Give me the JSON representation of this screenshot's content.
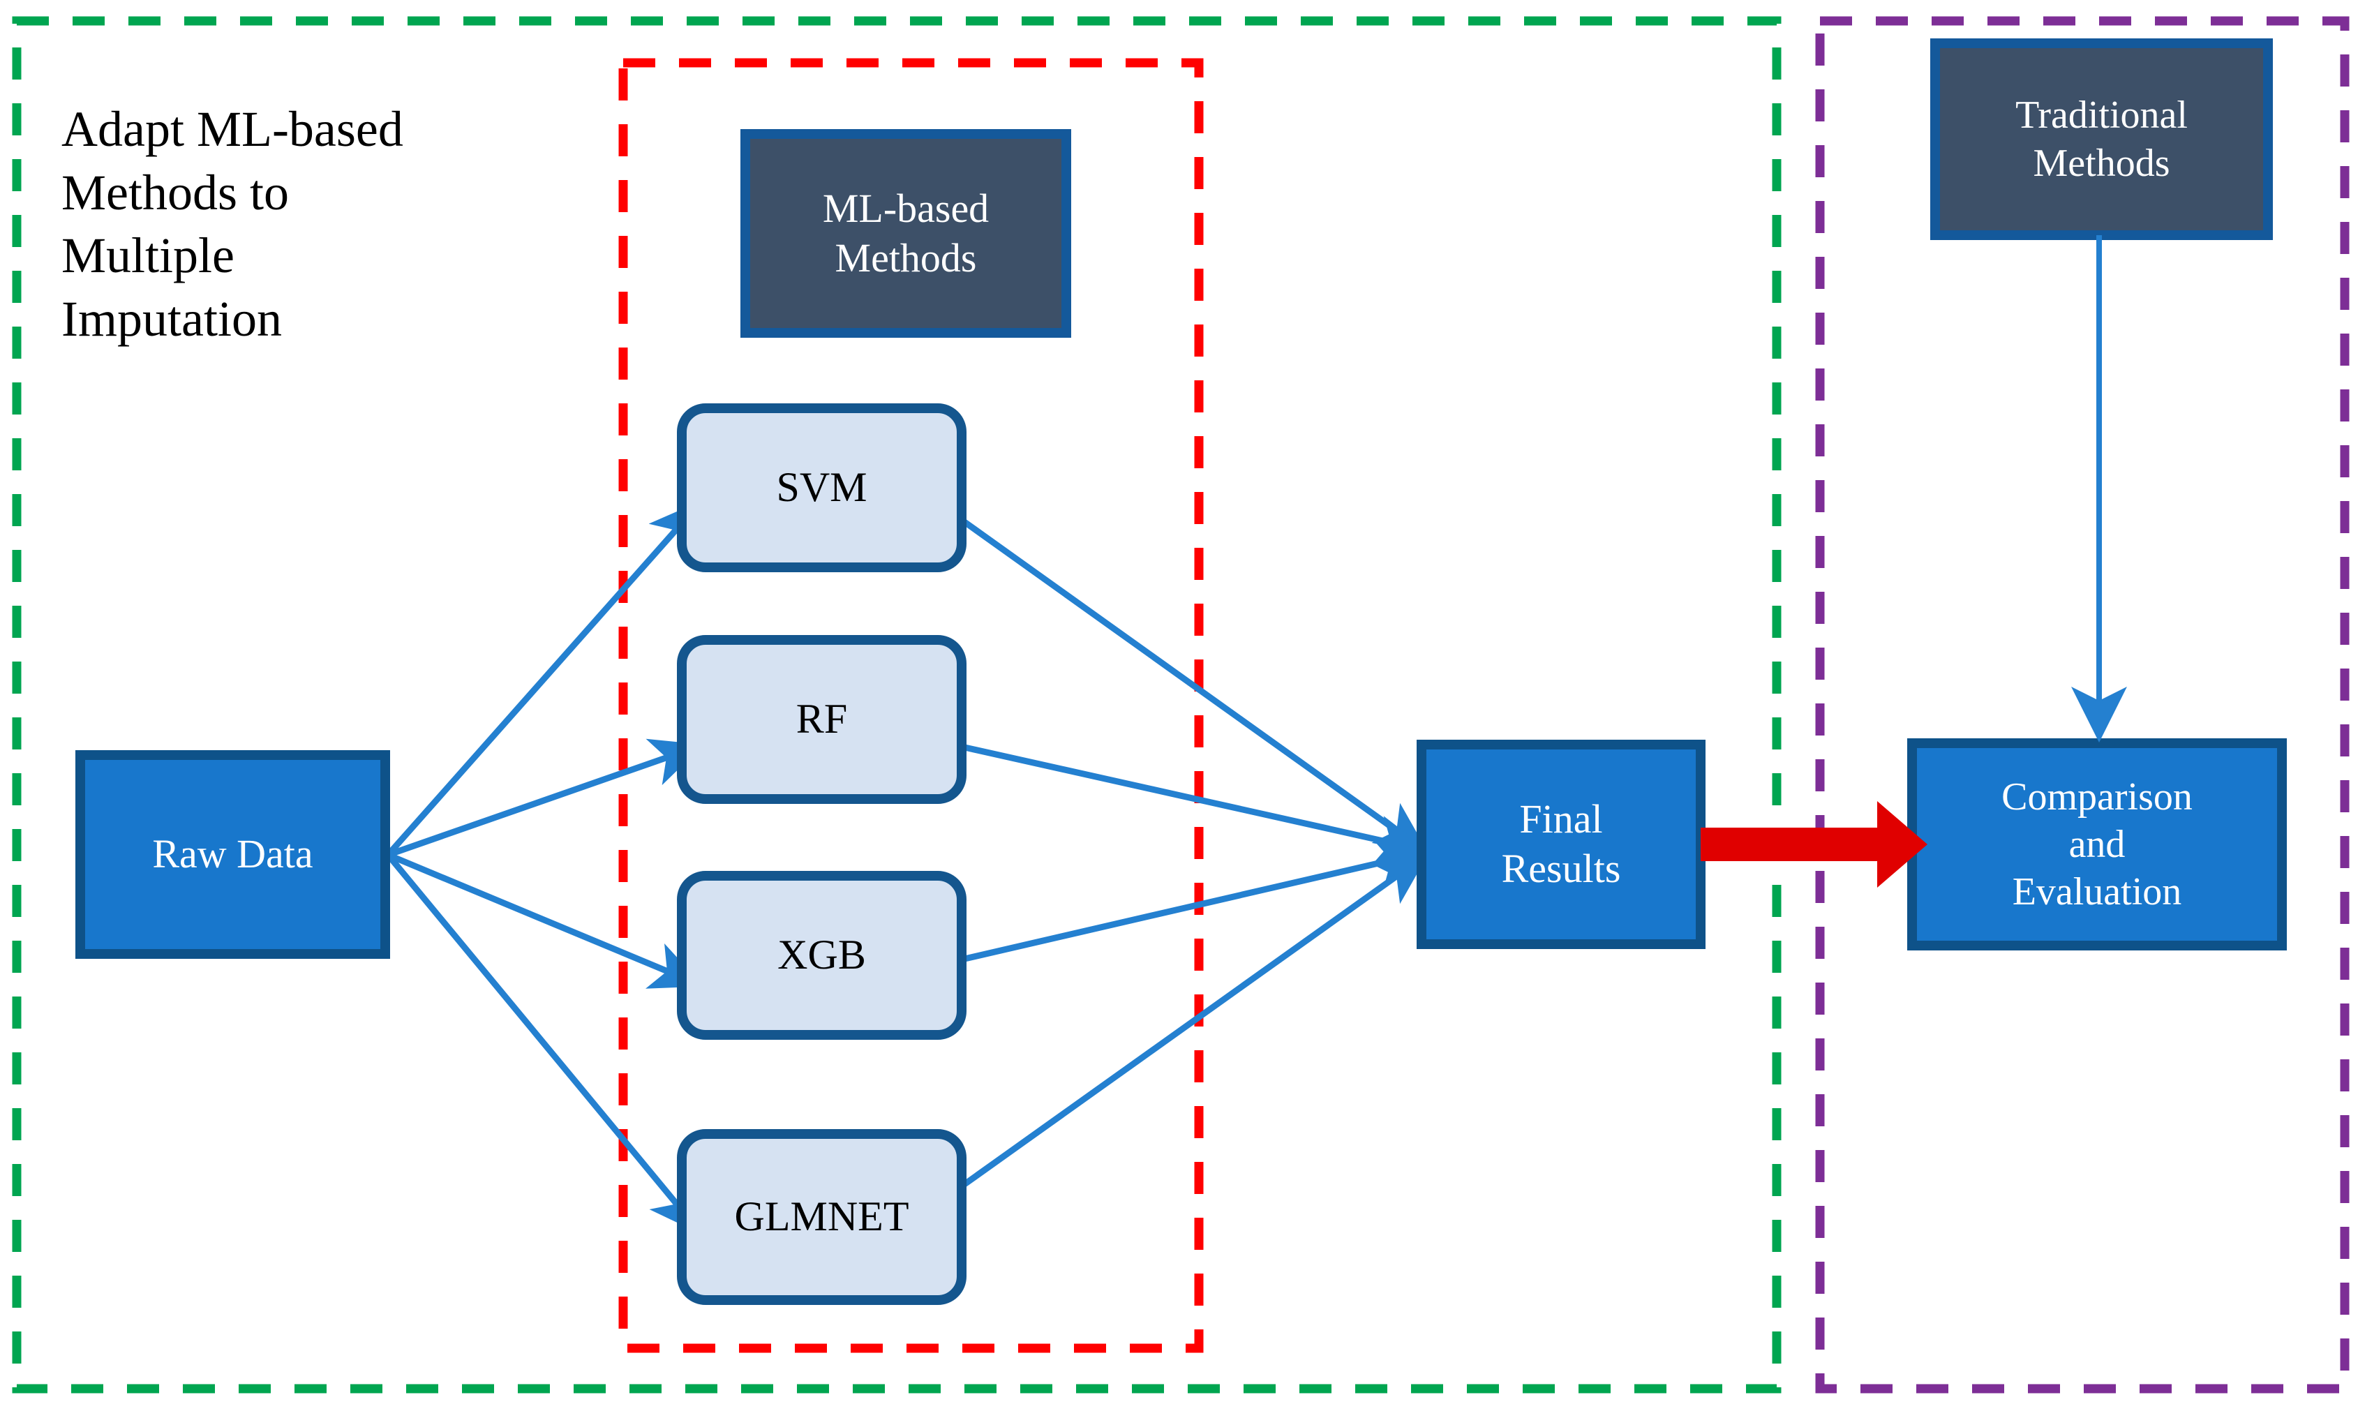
{
  "diagram": {
    "title_caption": "Adapt ML-based\nMethods to\nMultiple\nImputation",
    "colors": {
      "green_dashed": "#00A550",
      "red_dashed": "#FF0000",
      "purple_dashed": "#7D2E96",
      "dark_slate_fill": "#3D5068",
      "dark_slate_border": "#14599B",
      "blue_fill": "#1877CC",
      "blue_border": "#0E5289",
      "light_blue_fill": "#D6E2F2",
      "light_blue_border": "#14568E",
      "arrow_blue": "#2480D0",
      "arrow_red": "#E00000",
      "text_white": "#FFFFFF",
      "text_black": "#000000"
    },
    "groups": [
      {
        "id": "ml-group",
        "style": "green-dashed"
      },
      {
        "id": "ml-methods-group",
        "style": "red-dashed"
      },
      {
        "id": "traditional-group",
        "style": "purple-dashed"
      }
    ],
    "nodes": {
      "ml_based_methods": "ML-based\nMethods",
      "svm": "SVM",
      "rf": "RF",
      "xgb": "XGB",
      "glmnet": "GLMNET",
      "raw_data": "Raw Data",
      "final_results": "Final\nResults",
      "traditional_methods": "Traditional\nMethods",
      "comparison_evaluation": "Comparison\nand\nEvaluation"
    },
    "edges": [
      {
        "from": "raw_data",
        "to": "svm",
        "style": "blue-arrow"
      },
      {
        "from": "raw_data",
        "to": "rf",
        "style": "blue-arrow"
      },
      {
        "from": "raw_data",
        "to": "xgb",
        "style": "blue-arrow"
      },
      {
        "from": "raw_data",
        "to": "glmnet",
        "style": "blue-arrow"
      },
      {
        "from": "svm",
        "to": "final_results",
        "style": "blue-arrow"
      },
      {
        "from": "rf",
        "to": "final_results",
        "style": "blue-arrow"
      },
      {
        "from": "xgb",
        "to": "final_results",
        "style": "blue-arrow"
      },
      {
        "from": "glmnet",
        "to": "final_results",
        "style": "blue-arrow"
      },
      {
        "from": "final_results",
        "to": "comparison_evaluation",
        "style": "red-thick-arrow"
      },
      {
        "from": "traditional_methods",
        "to": "comparison_evaluation",
        "style": "blue-thin-arrow"
      }
    ]
  }
}
